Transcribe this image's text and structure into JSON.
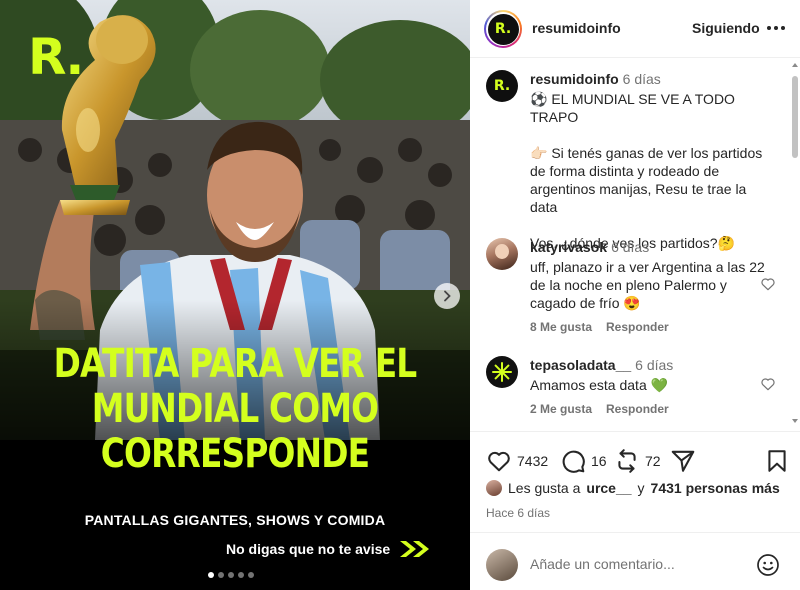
{
  "post": {
    "brand_mark": "R.",
    "headline": [
      "DATITA PARA VER EL",
      "MUNDIAL COMO",
      "CORRESPONDE"
    ],
    "subhead": "PANTALLAS GIGANTES, SHOWS Y COMIDA",
    "cta": "No digas que no te avise",
    "slide_count": 5,
    "active_slide": 1,
    "accent_color": "#d4ff1e"
  },
  "header": {
    "avatar_letter": "R.",
    "username": "resumidoinfo",
    "follow_label": "Siguiendo",
    "more_icon": "more-horizontal-icon"
  },
  "caption": {
    "username": "resumidoinfo",
    "time": "6 días",
    "line1": "⚽ EL MUNDIAL SE VE A TODO TRAPO",
    "line2": "👉🏻 Si tenés ganas de ver los partidos de forma distinta y rodeado de argentinos manijas, Resu te trae la data",
    "line3": "Vos, ¿dónde ves los partidos?🤔"
  },
  "comments": [
    {
      "username": "katyrivasok",
      "time": "6 días",
      "text": "uff, planazo ir a ver Argentina a las 22 de la noche en pleno Palermo y cagado de frío 😍",
      "likes": "8 Me gusta",
      "reply": "Responder"
    },
    {
      "username": "tepasoladata__",
      "time": "6 días",
      "text": "Amamos esta data 💚",
      "likes": "2 Me gusta",
      "reply": "Responder"
    }
  ],
  "actions": {
    "like_count": "7432",
    "comment_count": "16",
    "repost_count": "72"
  },
  "likes": {
    "prefix": "Les gusta a",
    "user": "urce__",
    "middle": "y",
    "others": "7431 personas más"
  },
  "posted_ago": "Hace 6 días",
  "comment_box": {
    "placeholder": "Añade un comentario..."
  }
}
